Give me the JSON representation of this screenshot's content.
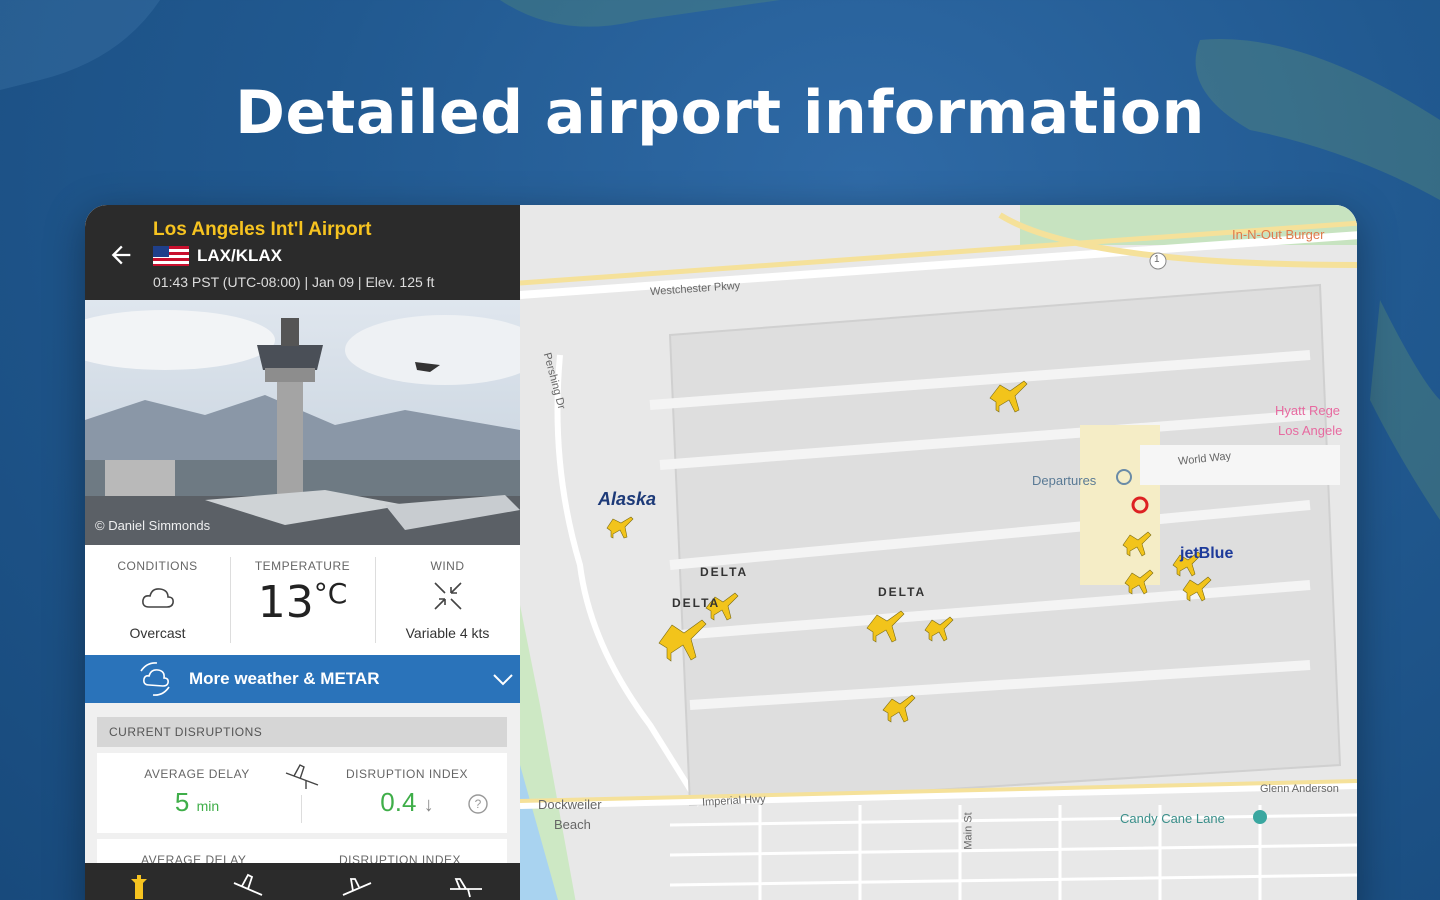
{
  "headline": "Detailed airport information",
  "airport": {
    "name": "Los Angeles Int'l Airport",
    "codes": "LAX/KLAX",
    "info_line": "01:43 PST (UTC-08:00) | Jan 09 | Elev. 125 ft"
  },
  "photo": {
    "credit": "© Daniel Simmonds"
  },
  "weather": {
    "conditions_label": "CONDITIONS",
    "conditions_value": "Overcast",
    "temperature_label": "TEMPERATURE",
    "temperature_value": "13",
    "temperature_unit": "°C",
    "wind_label": "WIND",
    "wind_value": "Variable 4 kts"
  },
  "more_weather_label": "More weather & METAR",
  "disruptions": {
    "header": "CURRENT DISRUPTIONS",
    "avg_delay_label": "AVERAGE DELAY",
    "avg_delay_value": "5",
    "avg_delay_unit": "min",
    "index_label": "DISRUPTION INDEX",
    "index_value": "0.4",
    "second_avg_delay_label": "AVERAGE DELAY",
    "second_index_label": "DISRUPTION INDEX"
  },
  "map": {
    "labels": {
      "innout": "In-N-Out Burger",
      "westchester": "Westchester Pkwy",
      "hyatt_1": "Hyatt Rege",
      "hyatt_2": "Los Angele",
      "world_way": "World Way",
      "departures": "Departures",
      "pershing": "Pershing Dr",
      "alaska": "Alaska",
      "delta1": "DELTA",
      "delta2": "DELTA",
      "delta3": "DELTA",
      "jetblue": "jetBlue",
      "dockweiler_1": "Dockweiler",
      "dockweiler_2": "Beach",
      "imperial": "Imperial Hwy",
      "main_st": "Main St",
      "candy": "Candy Cane Lane",
      "glenn": "Glenn Anderson",
      "route": "1"
    }
  },
  "colors": {
    "accent_yellow": "#f6c320",
    "header_dark": "#2b2b2b",
    "button_blue": "#2a73ba",
    "green": "#3fae49"
  }
}
